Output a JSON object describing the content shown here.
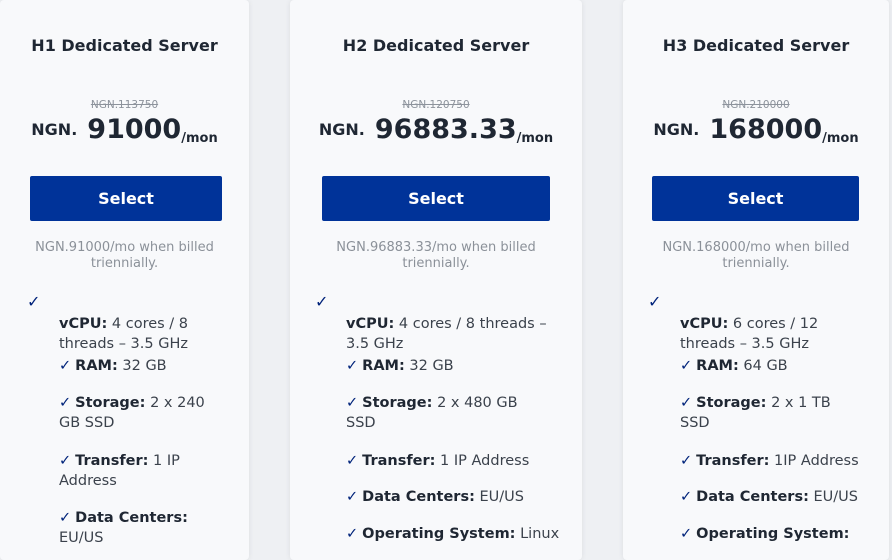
{
  "plans": [
    {
      "name": "H1 Dedicated Server",
      "old_price": "NGN.113750",
      "currency": "NGN.",
      "price": "91000",
      "period": "/mon",
      "button": "Select",
      "billed": "NGN.91000/mo when billed triennially.",
      "check_icon": "✓",
      "specs": {
        "vcpu_label": "vCPU:",
        "vcpu_value": "4 cores / 8 threads – 3.5 GHz",
        "ram_label": "RAM:",
        "ram_value": "32 GB",
        "storage_label": "Storage:",
        "storage_value": "2 x 240 GB SSD",
        "transfer_label": "Transfer:",
        "transfer_value": "1 IP Address",
        "dc_label": "Data Centers:",
        "dc_value": "EU/US"
      }
    },
    {
      "name": "H2 Dedicated Server",
      "old_price": "NGN.120750",
      "currency": "NGN.",
      "price": "96883.33",
      "period": "/mon",
      "button": "Select",
      "billed": "NGN.96883.33/mo when billed triennially.",
      "check_icon": "✓",
      "specs": {
        "vcpu_label": "vCPU:",
        "vcpu_value": "4 cores / 8 threads – 3.5 GHz",
        "ram_label": "RAM:",
        "ram_value": "32 GB",
        "storage_label": "Storage:",
        "storage_value": "2 x 480 GB SSD",
        "transfer_label": "Transfer:",
        "transfer_value": "1 IP Address",
        "dc_label": "Data Centers:",
        "dc_value": "EU/US",
        "os_label": "Operating System:",
        "os_value": "Linux"
      }
    },
    {
      "name": "H3 Dedicated Server",
      "old_price": "NGN.210000",
      "currency": "NGN.",
      "price": "168000",
      "period": "/mon",
      "button": "Select",
      "billed": "NGN.168000/mo when billed triennially.",
      "check_icon": "✓",
      "specs": {
        "vcpu_label": "vCPU:",
        "vcpu_value": "6 cores / 12 threads – 3.5 GHz",
        "ram_label": "RAM:",
        "ram_value": "64 GB",
        "storage_label": "Storage:",
        "storage_value": "2 x 1 TB SSD",
        "transfer_label": "Transfer:",
        "transfer_value": "1IP Address",
        "dc_label": "Data Centers:",
        "dc_value": "EU/US",
        "os_label": "Operating System:"
      }
    }
  ],
  "colors": {
    "button_bg": "#003399",
    "check": "#00237a",
    "muted": "#8b9199"
  }
}
